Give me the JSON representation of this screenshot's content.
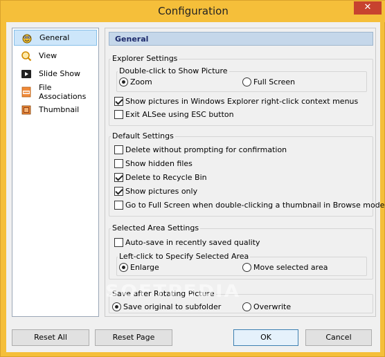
{
  "window": {
    "title": "Configuration",
    "close_symbol": "✕"
  },
  "nav": {
    "items": [
      {
        "label": "General",
        "icon": "general-icon"
      },
      {
        "label": "View",
        "icon": "view-icon"
      },
      {
        "label": "Slide Show",
        "icon": "slideshow-icon"
      },
      {
        "label": "File Associations",
        "icon": "file-associations-icon"
      },
      {
        "label": "Thumbnail",
        "icon": "thumbnail-icon"
      }
    ]
  },
  "pane": {
    "header": "General",
    "explorer": {
      "title": "Explorer Settings",
      "dblclick_title": "Double-click to Show Picture",
      "zoom": "Zoom",
      "full_screen": "Full Screen",
      "show_pictures_context": "Show pictures in Windows Explorer right-click context menus",
      "exit_esc": "Exit ALSee using ESC button"
    },
    "default": {
      "title": "Default Settings",
      "delete_without_prompt": "Delete without prompting for confirmation",
      "show_hidden": "Show hidden files",
      "delete_recycle": "Delete to Recycle Bin",
      "show_pictures_only": "Show pictures only",
      "go_full_screen": "Go to Full Screen when double-clicking a thumbnail in Browse mode"
    },
    "selected_area": {
      "title": "Selected Area Settings",
      "auto_save": "Auto-save in recently saved quality",
      "leftclick_title": "Left-click to Specify Selected Area",
      "enlarge": "Enlarge",
      "move_area": "Move selected area"
    },
    "rotating": {
      "title": "Save after Rotating Picture",
      "save_original": "Save original to subfolder",
      "overwrite": "Overwrite"
    }
  },
  "buttons": {
    "reset_all": "Reset All",
    "reset_page": "Reset Page",
    "ok": "OK",
    "cancel": "Cancel"
  },
  "watermark": "SOFTPEDIA",
  "colors": {
    "titlebar": "#f5bf3a",
    "selected_nav": "#cde6fa",
    "header_bg": "#c5d7ea",
    "close_button": "#c7432f"
  }
}
